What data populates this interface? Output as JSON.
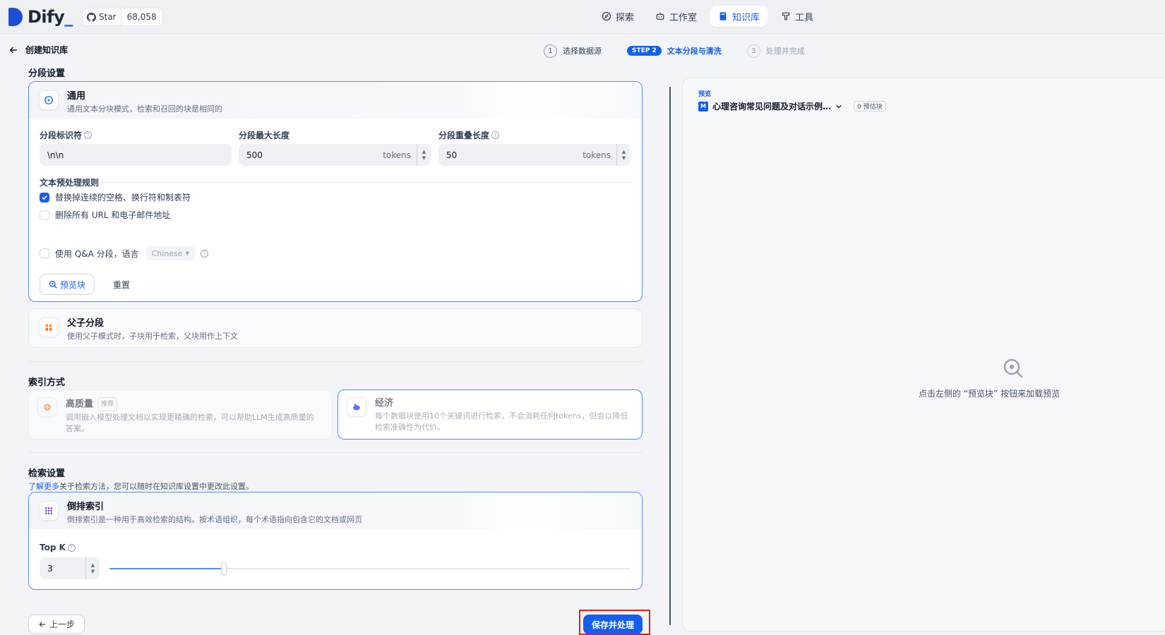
{
  "brand": {
    "name": "Dify",
    "underscore": "_"
  },
  "github": {
    "star_label": "Star",
    "star_count": "68,058"
  },
  "nav": [
    {
      "label": "探索",
      "icon": "compass-icon",
      "active": false
    },
    {
      "label": "工作室",
      "icon": "robot-icon",
      "active": false
    },
    {
      "label": "知识库",
      "icon": "book-icon",
      "active": true
    },
    {
      "label": "工具",
      "icon": "hammer-icon",
      "active": false
    }
  ],
  "header": {
    "back_label": "创建知识库"
  },
  "steps": [
    {
      "num": "1",
      "label": "选择数据源",
      "state": "done"
    },
    {
      "num": "STEP 2",
      "label": "文本分段与清洗",
      "state": "active"
    },
    {
      "num": "3",
      "label": "处理并完成",
      "state": "pending"
    }
  ],
  "segment": {
    "section_title": "分段设置",
    "general": {
      "title": "通用",
      "desc": "通用文本分块模式，检索和召回的块是相同的",
      "delimiter_label": "分段标识符",
      "delimiter_value": "\\n\\n",
      "max_len_label": "分段最大长度",
      "max_len_value": "500",
      "overlap_label": "分段重叠长度",
      "overlap_value": "50",
      "unit": "tokens",
      "rules_label": "文本预处理规则",
      "rule1": "替换掉连续的空格、换行符和制表符",
      "rule1_checked": true,
      "rule2": "删除所有 URL 和电子邮件地址",
      "rule2_checked": false,
      "qa_label": "使用 Q&A 分段，语言",
      "qa_language": "Chinese",
      "qa_checked": false,
      "preview_btn": "预览块",
      "reset_btn": "重置"
    },
    "parent_child": {
      "title": "父子分段",
      "desc": "使用父子模式时，子块用于检索，父块用作上下文"
    }
  },
  "index": {
    "section_title": "索引方式",
    "high_quality": {
      "title": "高质量",
      "tag": "推荐",
      "desc": "调用嵌入模型处理文档以实现更精确的检索，可以帮助LLM生成高质量的答案。"
    },
    "economy": {
      "title": "经济",
      "desc": "每个数据块使用10个关键词进行检索，不会消耗任何tokens，但会以降低检索准确性为代价。"
    }
  },
  "retrieval": {
    "section_title": "检索设置",
    "learn_more_link": "了解更多",
    "learn_more_text": "关于检索方法，您可以随时在知识库设置中更改此设置。",
    "inverted": {
      "title": "倒排索引",
      "desc": "倒排索引是一种用于高效检索的结构。按术语组织，每个术语指向包含它的文档或网页"
    },
    "topk_label": "Top K",
    "topk_value": "3",
    "topk_fraction": 0.22
  },
  "footer": {
    "prev_btn": "上一步",
    "save_btn": "保存并处理"
  },
  "preview": {
    "label": "预览",
    "doc_name": "心理咨询常见问题及对话示例…",
    "chunk_count": "0 预估块",
    "empty_text": "点击左侧的 “预览块” 按钮来加载预览"
  },
  "colors": {
    "accent": "#155eef",
    "focus_ring": "#e11d1d"
  }
}
